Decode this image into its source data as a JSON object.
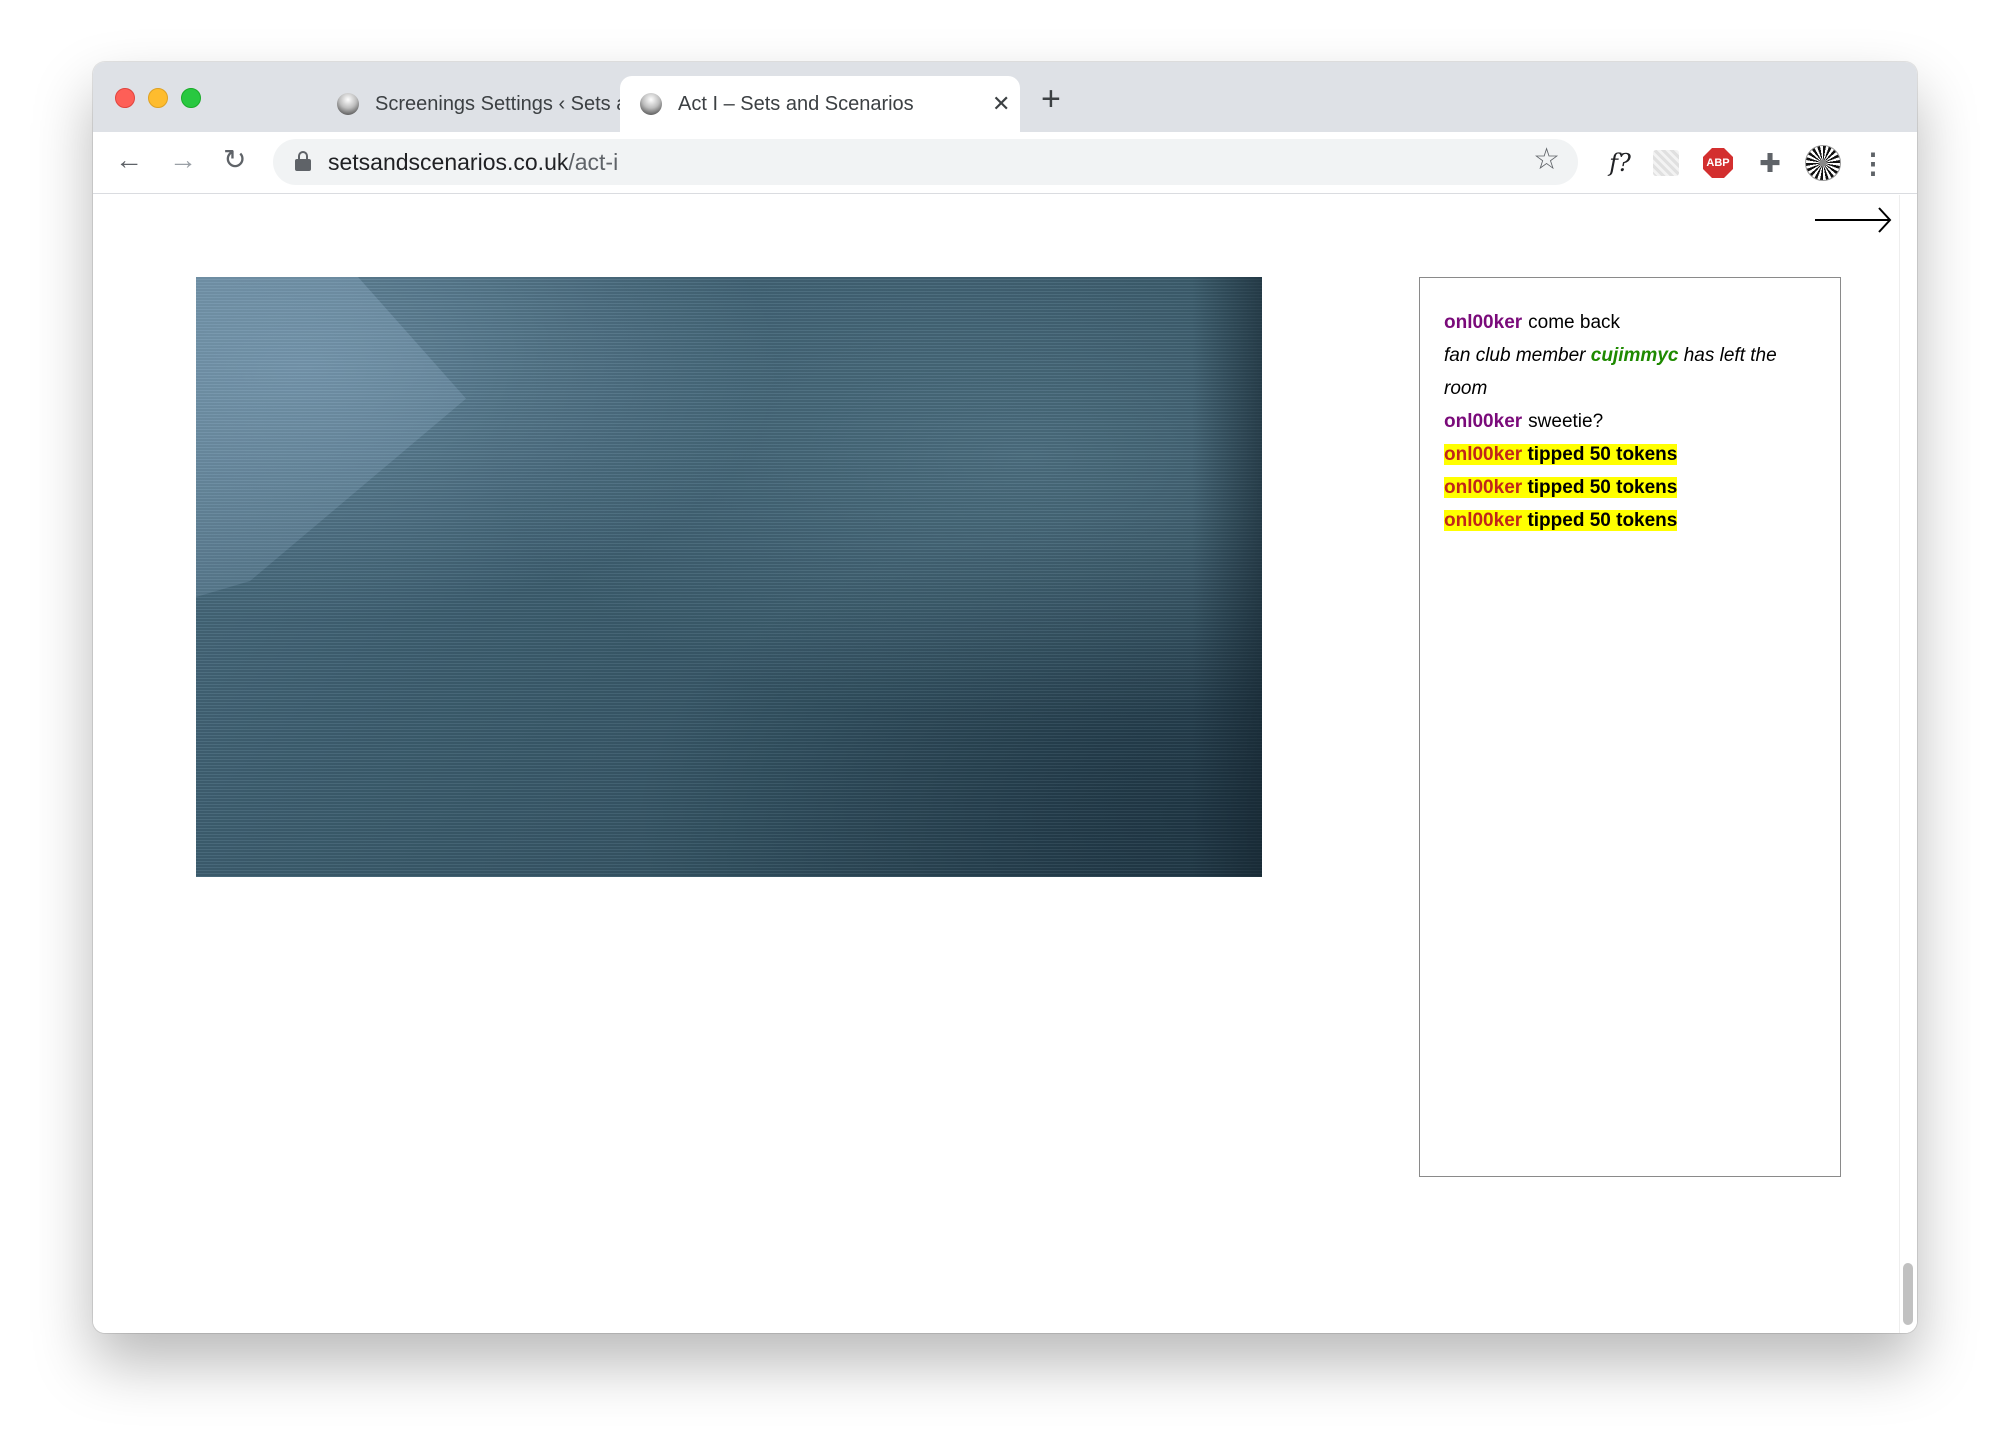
{
  "browser": {
    "tabs": [
      {
        "title": "Screenings Settings ‹ Sets and Scenarios",
        "active": false
      },
      {
        "title": "Act I – Sets and Scenarios",
        "active": true
      }
    ],
    "new_tab_label": "+",
    "address": {
      "domain": "setsandscenarios.co.uk",
      "path": "/act-i"
    },
    "extensions": {
      "font_ext_label": "f?",
      "abp_label": "ABP"
    }
  },
  "chat": {
    "messages": [
      {
        "user": "onl00ker",
        "text": "come back"
      },
      {
        "system_prefix": "fan club member",
        "system_user": "cujimmyc",
        "system_suffix": "has left the room"
      },
      {
        "user": "onl00ker",
        "text": "sweetie?"
      },
      {
        "tip_user": "onl00ker",
        "tip_text": "tipped 50 tokens"
      },
      {
        "tip_user": "onl00ker",
        "tip_text": "tipped 50 tokens"
      },
      {
        "tip_user": "onl00ker",
        "tip_text": "tipped 50 tokens"
      }
    ]
  },
  "colors": {
    "username": "#7a0a7a",
    "fan_club_user": "#1e8a00",
    "tip_highlight": "#ffff00",
    "tip_user": "#c0261a"
  }
}
